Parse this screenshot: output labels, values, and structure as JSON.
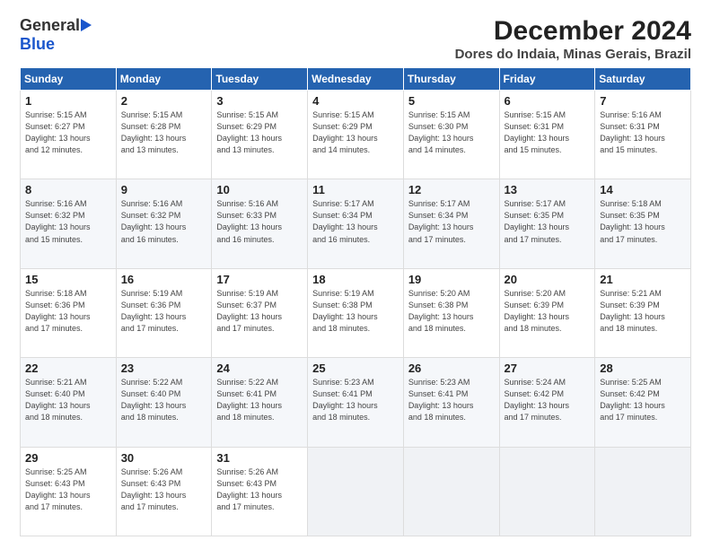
{
  "logo": {
    "line1": "General",
    "line2": "Blue"
  },
  "title": "December 2024",
  "subtitle": "Dores do Indaia, Minas Gerais, Brazil",
  "days_of_week": [
    "Sunday",
    "Monday",
    "Tuesday",
    "Wednesday",
    "Thursday",
    "Friday",
    "Saturday"
  ],
  "weeks": [
    [
      {
        "day": "1",
        "info": "Sunrise: 5:15 AM\nSunset: 6:27 PM\nDaylight: 13 hours\nand 12 minutes."
      },
      {
        "day": "2",
        "info": "Sunrise: 5:15 AM\nSunset: 6:28 PM\nDaylight: 13 hours\nand 13 minutes."
      },
      {
        "day": "3",
        "info": "Sunrise: 5:15 AM\nSunset: 6:29 PM\nDaylight: 13 hours\nand 13 minutes."
      },
      {
        "day": "4",
        "info": "Sunrise: 5:15 AM\nSunset: 6:29 PM\nDaylight: 13 hours\nand 14 minutes."
      },
      {
        "day": "5",
        "info": "Sunrise: 5:15 AM\nSunset: 6:30 PM\nDaylight: 13 hours\nand 14 minutes."
      },
      {
        "day": "6",
        "info": "Sunrise: 5:15 AM\nSunset: 6:31 PM\nDaylight: 13 hours\nand 15 minutes."
      },
      {
        "day": "7",
        "info": "Sunrise: 5:16 AM\nSunset: 6:31 PM\nDaylight: 13 hours\nand 15 minutes."
      }
    ],
    [
      {
        "day": "8",
        "info": "Sunrise: 5:16 AM\nSunset: 6:32 PM\nDaylight: 13 hours\nand 15 minutes."
      },
      {
        "day": "9",
        "info": "Sunrise: 5:16 AM\nSunset: 6:32 PM\nDaylight: 13 hours\nand 16 minutes."
      },
      {
        "day": "10",
        "info": "Sunrise: 5:16 AM\nSunset: 6:33 PM\nDaylight: 13 hours\nand 16 minutes."
      },
      {
        "day": "11",
        "info": "Sunrise: 5:17 AM\nSunset: 6:34 PM\nDaylight: 13 hours\nand 16 minutes."
      },
      {
        "day": "12",
        "info": "Sunrise: 5:17 AM\nSunset: 6:34 PM\nDaylight: 13 hours\nand 17 minutes."
      },
      {
        "day": "13",
        "info": "Sunrise: 5:17 AM\nSunset: 6:35 PM\nDaylight: 13 hours\nand 17 minutes."
      },
      {
        "day": "14",
        "info": "Sunrise: 5:18 AM\nSunset: 6:35 PM\nDaylight: 13 hours\nand 17 minutes."
      }
    ],
    [
      {
        "day": "15",
        "info": "Sunrise: 5:18 AM\nSunset: 6:36 PM\nDaylight: 13 hours\nand 17 minutes."
      },
      {
        "day": "16",
        "info": "Sunrise: 5:19 AM\nSunset: 6:36 PM\nDaylight: 13 hours\nand 17 minutes."
      },
      {
        "day": "17",
        "info": "Sunrise: 5:19 AM\nSunset: 6:37 PM\nDaylight: 13 hours\nand 17 minutes."
      },
      {
        "day": "18",
        "info": "Sunrise: 5:19 AM\nSunset: 6:38 PM\nDaylight: 13 hours\nand 18 minutes."
      },
      {
        "day": "19",
        "info": "Sunrise: 5:20 AM\nSunset: 6:38 PM\nDaylight: 13 hours\nand 18 minutes."
      },
      {
        "day": "20",
        "info": "Sunrise: 5:20 AM\nSunset: 6:39 PM\nDaylight: 13 hours\nand 18 minutes."
      },
      {
        "day": "21",
        "info": "Sunrise: 5:21 AM\nSunset: 6:39 PM\nDaylight: 13 hours\nand 18 minutes."
      }
    ],
    [
      {
        "day": "22",
        "info": "Sunrise: 5:21 AM\nSunset: 6:40 PM\nDaylight: 13 hours\nand 18 minutes."
      },
      {
        "day": "23",
        "info": "Sunrise: 5:22 AM\nSunset: 6:40 PM\nDaylight: 13 hours\nand 18 minutes."
      },
      {
        "day": "24",
        "info": "Sunrise: 5:22 AM\nSunset: 6:41 PM\nDaylight: 13 hours\nand 18 minutes."
      },
      {
        "day": "25",
        "info": "Sunrise: 5:23 AM\nSunset: 6:41 PM\nDaylight: 13 hours\nand 18 minutes."
      },
      {
        "day": "26",
        "info": "Sunrise: 5:23 AM\nSunset: 6:41 PM\nDaylight: 13 hours\nand 18 minutes."
      },
      {
        "day": "27",
        "info": "Sunrise: 5:24 AM\nSunset: 6:42 PM\nDaylight: 13 hours\nand 17 minutes."
      },
      {
        "day": "28",
        "info": "Sunrise: 5:25 AM\nSunset: 6:42 PM\nDaylight: 13 hours\nand 17 minutes."
      }
    ],
    [
      {
        "day": "29",
        "info": "Sunrise: 5:25 AM\nSunset: 6:43 PM\nDaylight: 13 hours\nand 17 minutes."
      },
      {
        "day": "30",
        "info": "Sunrise: 5:26 AM\nSunset: 6:43 PM\nDaylight: 13 hours\nand 17 minutes."
      },
      {
        "day": "31",
        "info": "Sunrise: 5:26 AM\nSunset: 6:43 PM\nDaylight: 13 hours\nand 17 minutes."
      },
      {
        "day": "",
        "info": ""
      },
      {
        "day": "",
        "info": ""
      },
      {
        "day": "",
        "info": ""
      },
      {
        "day": "",
        "info": ""
      }
    ]
  ]
}
